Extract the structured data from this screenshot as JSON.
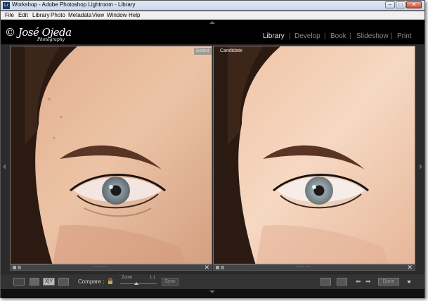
{
  "window": {
    "title": "Workshop - Adobe Photoshop Lightroom - Library",
    "app_icon_text": "Lr",
    "controls": {
      "minimize": "–",
      "maximize": "□",
      "close": "✕"
    }
  },
  "menubar": {
    "items": [
      {
        "label": "File"
      },
      {
        "label": "Edit"
      },
      {
        "label": "Library"
      },
      {
        "label": "Photo"
      },
      {
        "label": "Metadata"
      },
      {
        "label": "View"
      },
      {
        "label": "Window"
      },
      {
        "label": "Help"
      }
    ]
  },
  "identity": {
    "logo_text": "© José Ojeda",
    "logo_subtitle": "Photography"
  },
  "modules": [
    {
      "label": "Library",
      "active": true
    },
    {
      "label": "Develop",
      "active": false
    },
    {
      "label": "Book",
      "active": false
    },
    {
      "label": "Slideshow",
      "active": false
    },
    {
      "label": "Print",
      "active": false
    }
  ],
  "compare": {
    "select_label": "Select",
    "candidate_label": "Candidate"
  },
  "toolbar": {
    "compare_label": "Compare :",
    "zoom_label": "Zoom",
    "zoom_value": "1:1",
    "zoom_level": 0.45,
    "sync_label": "Sync",
    "done_label": "Done",
    "compare_view_text": "X|Y"
  },
  "colors": {
    "panel_bg": "#2b2b2b",
    "top_panel_bg": "#000000",
    "active_module": "#e8e8e8",
    "inactive_module": "#8a8a8a"
  }
}
